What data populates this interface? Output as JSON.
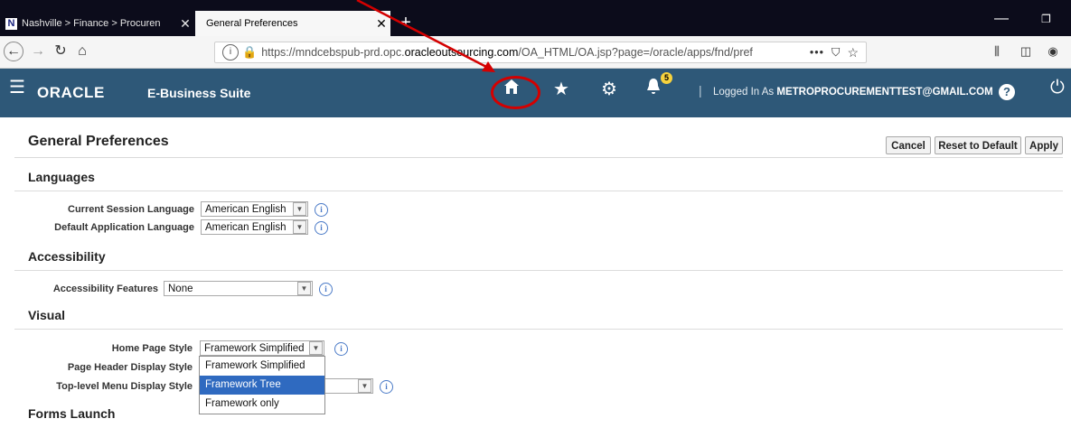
{
  "browser": {
    "tabs": [
      {
        "label": "Nashville > Finance > Procuren",
        "favicon": "N"
      },
      {
        "label": "General Preferences"
      }
    ],
    "url": "https://mndcebspub-prd.opc.oracleoutsourcing.com/OA_HTML/OA.jsp?page=/oracle/apps/fnd/pref",
    "url_domain_bold": "oracleoutsourcing.com",
    "url_prefix": "https://mndcebspub-prd.opc.",
    "url_suffix": "/OA_HTML/OA.jsp?page=/oracle/apps/fnd/pref"
  },
  "header": {
    "brand": "ORACLE",
    "suite": "E-Business Suite",
    "notification_count": "5",
    "logged_in_prefix": "Logged In As",
    "user": "METROPROCUREMENTTEST@GMAIL.COM",
    "background_color": "#2e5878"
  },
  "page": {
    "title": "General Preferences",
    "buttons": {
      "cancel": "Cancel",
      "reset": "Reset to Default",
      "apply": "Apply"
    },
    "sections": {
      "languages": "Languages",
      "accessibility": "Accessibility",
      "visual": "Visual",
      "forms_launch": "Forms Launch"
    },
    "fields": {
      "current_session_language": {
        "label": "Current Session Language",
        "value": "American English"
      },
      "default_application_language": {
        "label": "Default Application Language",
        "value": "American English"
      },
      "accessibility_features": {
        "label": "Accessibility Features",
        "value": "None"
      },
      "home_page_style": {
        "label": "Home Page Style",
        "value": "Framework Simplified"
      },
      "page_header_display_style": {
        "label": "Page Header Display Style"
      },
      "top_level_menu_display_style": {
        "label": "Top-level Menu Display Style"
      }
    },
    "home_page_style_options": [
      "Framework Simplified",
      "Framework Tree",
      "Framework only"
    ],
    "highlighted_option": "Framework Tree"
  },
  "annotation": {
    "color": "#d40000"
  }
}
